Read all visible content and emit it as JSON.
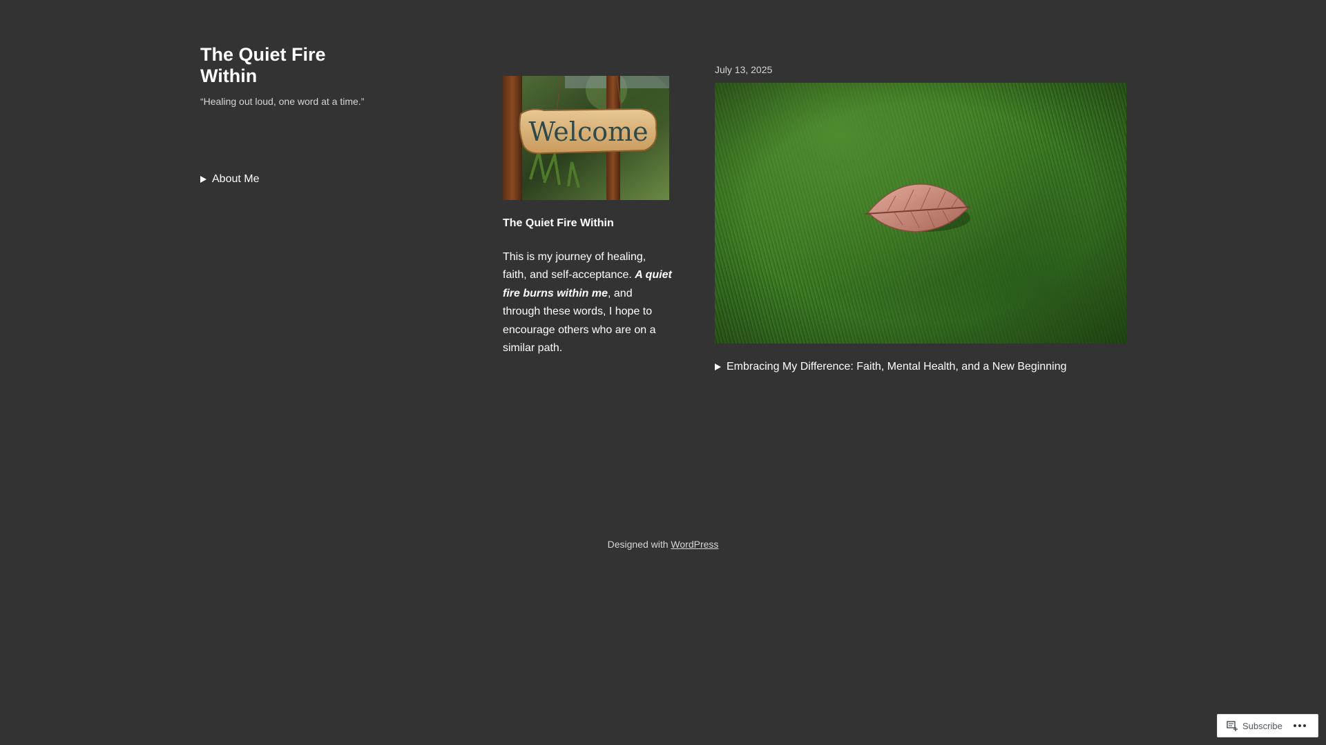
{
  "site": {
    "title": "The Quiet Fire Within",
    "tagline": "“Healing out loud, one word at a time.”"
  },
  "sidebar": {
    "about_label": "About Me"
  },
  "welcome_widget": {
    "image_sign_text": "Welcome",
    "title": "The Quiet Fire Within",
    "body_intro": "This is my journey of healing, faith, and self-acceptance. ",
    "body_emphasis": "A quiet fire burns within me",
    "body_rest": ", and through these words, I hope to encourage others who are on a similar path."
  },
  "post": {
    "date": "July 13, 2025",
    "title": "Embracing My Difference: Faith, Mental Health, and a New Beginning"
  },
  "footer": {
    "prefix": "Designed with ",
    "link_label": "WordPress"
  },
  "subscribe_bar": {
    "subscribe_label": "Subscribe"
  },
  "colors": {
    "background": "#333333",
    "text": "#ffffff",
    "muted_text": "#d6d6d6"
  }
}
